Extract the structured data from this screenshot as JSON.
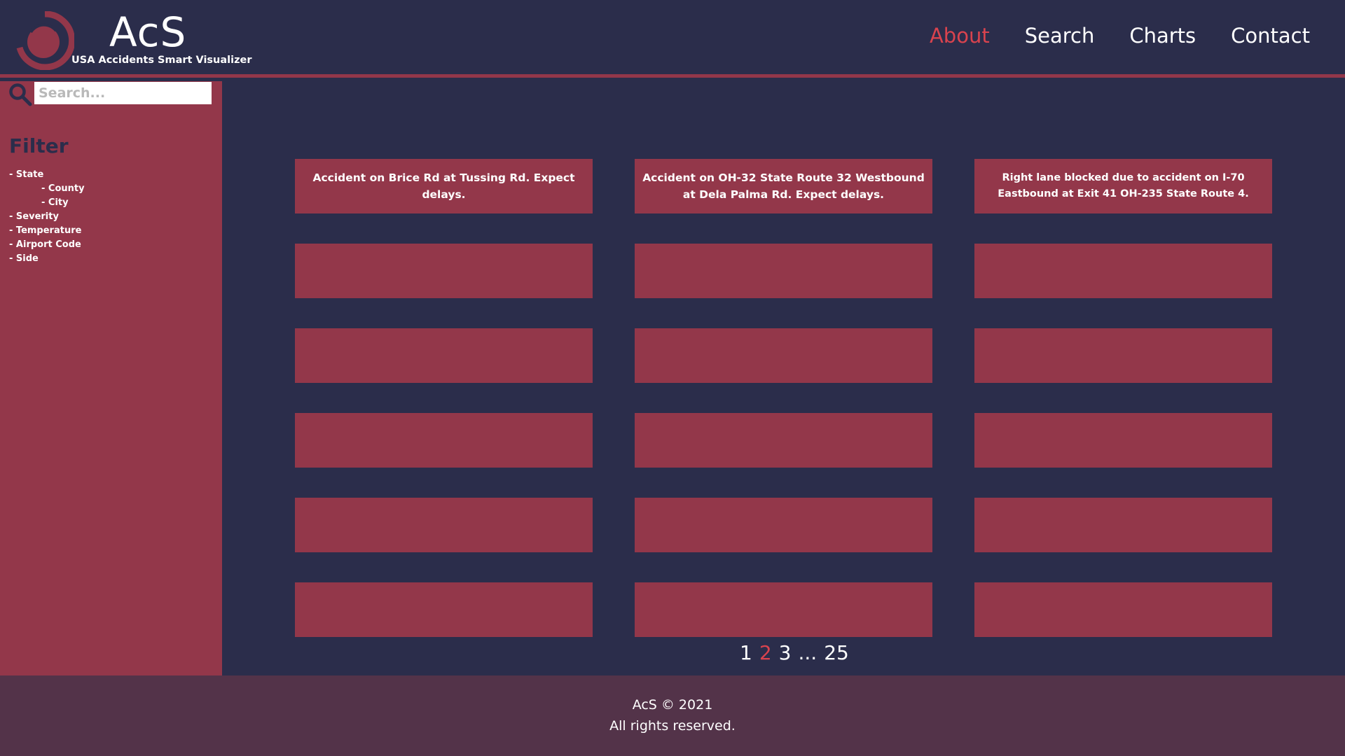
{
  "brand": {
    "title": "AcS",
    "subtitle": "USA Accidents Smart Visualizer",
    "logo_icon": "ring-logo-icon",
    "accent": "#93374a",
    "active": "#d9434e"
  },
  "nav": [
    {
      "label": "About",
      "active": true
    },
    {
      "label": "Search",
      "active": false
    },
    {
      "label": "Charts",
      "active": false
    },
    {
      "label": "Contact",
      "active": false
    }
  ],
  "sidebar": {
    "search_placeholder": "Search...",
    "search_icon": "search-icon",
    "filter_title": "Filter",
    "filters": [
      {
        "label": "- State",
        "sub": false
      },
      {
        "label": "- County",
        "sub": true
      },
      {
        "label": "- City",
        "sub": true
      },
      {
        "label": "- Severity",
        "sub": false
      },
      {
        "label": "- Temperature",
        "sub": false
      },
      {
        "label": "- Airport Code",
        "sub": false
      },
      {
        "label": "- Side",
        "sub": false
      }
    ]
  },
  "cards": [
    {
      "text": "Accident on Brice Rd at Tussing Rd. Expect delays."
    },
    {
      "text": "Accident on OH-32 State Route 32 Westbound at Dela Palma Rd. Expect delays."
    },
    {
      "text": "Right lane blocked due to accident on I-70 Eastbound at Exit 41 OH-235 State Route 4."
    },
    {
      "text": ""
    },
    {
      "text": ""
    },
    {
      "text": ""
    },
    {
      "text": ""
    },
    {
      "text": ""
    },
    {
      "text": ""
    },
    {
      "text": ""
    },
    {
      "text": ""
    },
    {
      "text": ""
    },
    {
      "text": ""
    },
    {
      "text": ""
    },
    {
      "text": ""
    },
    {
      "text": ""
    },
    {
      "text": ""
    },
    {
      "text": ""
    }
  ],
  "pager": [
    {
      "label": "1",
      "current": false
    },
    {
      "label": "2",
      "current": true
    },
    {
      "label": "3",
      "current": false
    },
    {
      "label": "...",
      "current": false
    },
    {
      "label": "25",
      "current": false
    }
  ],
  "footer": {
    "line1": "AcS © 2021",
    "line2": "All rights reserved."
  }
}
